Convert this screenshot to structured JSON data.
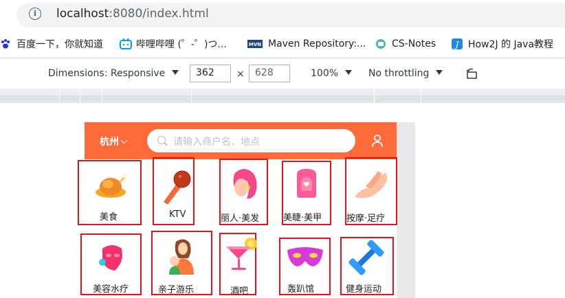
{
  "browser": {
    "url_host": "localhost",
    "url_rest": ":8080/index.html"
  },
  "bookmarks": [
    {
      "label": "百度一下，你就知道",
      "icon": "baidu-icon"
    },
    {
      "label": "哔哩哔哩 (゜-゜)つ...",
      "icon": "bilibili-icon"
    },
    {
      "label": "Maven Repository:...",
      "icon": "maven-icon"
    },
    {
      "label": "CS-Notes",
      "icon": "cs-notes-icon"
    },
    {
      "label": "How2J 的 Java教程",
      "icon": "how2j-icon"
    }
  ],
  "devtools": {
    "dimensions_label": "Dimensions: Responsive",
    "width": "362",
    "height": "628",
    "times": "×",
    "zoom": "100%",
    "throttling": "No throttling"
  },
  "app": {
    "city": "杭州",
    "search_placeholder": "请输入商户名、地点",
    "categories": [
      {
        "label": "美食",
        "icon": "roast-chicken-icon"
      },
      {
        "label": "KTV",
        "icon": "microphone-icon"
      },
      {
        "label": "丽人·美发",
        "icon": "hair-woman-icon"
      },
      {
        "label": "美睫·美甲",
        "icon": "nail-icon"
      },
      {
        "label": "按摩·足疗",
        "icon": "foot-massage-icon"
      },
      {
        "label": "美容水疗",
        "icon": "face-mask-icon"
      },
      {
        "label": "亲子游乐",
        "icon": "parent-child-icon"
      },
      {
        "label": "酒吧",
        "icon": "cocktail-icon"
      },
      {
        "label": "轰趴馆",
        "icon": "party-mask-icon"
      },
      {
        "label": "健身运动",
        "icon": "dumbbell-icon"
      }
    ]
  },
  "colors": {
    "header": "#ff6a3a",
    "highlight_border": "#d9161c"
  }
}
